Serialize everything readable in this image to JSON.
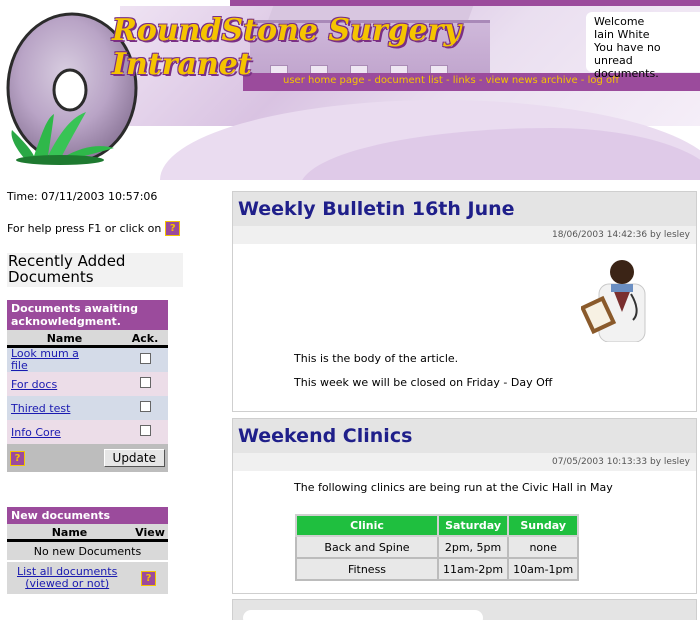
{
  "header": {
    "logo_line1": "RoundStone Surgery",
    "logo_line2": "Intranet",
    "nav": [
      {
        "label": "user home page"
      },
      {
        "label": "document list"
      },
      {
        "label": "links"
      },
      {
        "label": "view news archive"
      },
      {
        "label": "log off"
      }
    ],
    "nav_separator": " - ",
    "welcome": {
      "line1": "Welcome",
      "line2": "Iain White",
      "line3": "You have no",
      "line4": "unread documents."
    }
  },
  "sidebar": {
    "time_label": "Time: 07/11/2003 10:57:06",
    "help_text": "For help press F1 or click on",
    "help_icon": "?",
    "recent_heading_1": "Recently Added",
    "recent_heading_2": "Documents",
    "awaiting": {
      "title": "Documents awaiting acknowledgment.",
      "col_name": "Name",
      "col_ack": "Ack.",
      "rows": [
        {
          "name": "Look mum a file",
          "checked": false
        },
        {
          "name": "For docs",
          "checked": false
        },
        {
          "name": "Thired test",
          "checked": false
        },
        {
          "name": "Info Core",
          "checked": false
        }
      ],
      "update_label": "Update"
    },
    "new_docs": {
      "title": "New documents",
      "col_name": "Name",
      "col_view": "View",
      "empty_text": "No new Documents",
      "list_all_1": "List all documents",
      "list_all_2": "(viewed or not)"
    }
  },
  "articles": [
    {
      "title": "Weekly Bulletin 16th June",
      "meta": "18/06/2003 14:42:36 by lesley",
      "paragraphs": [
        "This is the body of the article.",
        "This week we will be closed on Friday - Day Off"
      ]
    },
    {
      "title": "Weekend Clinics",
      "meta": "07/05/2003 10:13:33 by lesley",
      "intro": "The following clinics are being run at the Civic Hall in May",
      "table": {
        "headers": [
          "Clinic",
          "Saturday",
          "Sunday"
        ],
        "rows": [
          [
            "Back and Spine",
            "2pm, 5pm",
            "none"
          ],
          [
            "Fitness",
            "11am-2pm",
            "10am-1pm"
          ]
        ]
      }
    }
  ],
  "colors": {
    "brand_purple": "#9b4b9c",
    "brand_yellow": "#f5c400",
    "title_blue": "#1f1f8a",
    "table_green": "#1fbf3f"
  }
}
